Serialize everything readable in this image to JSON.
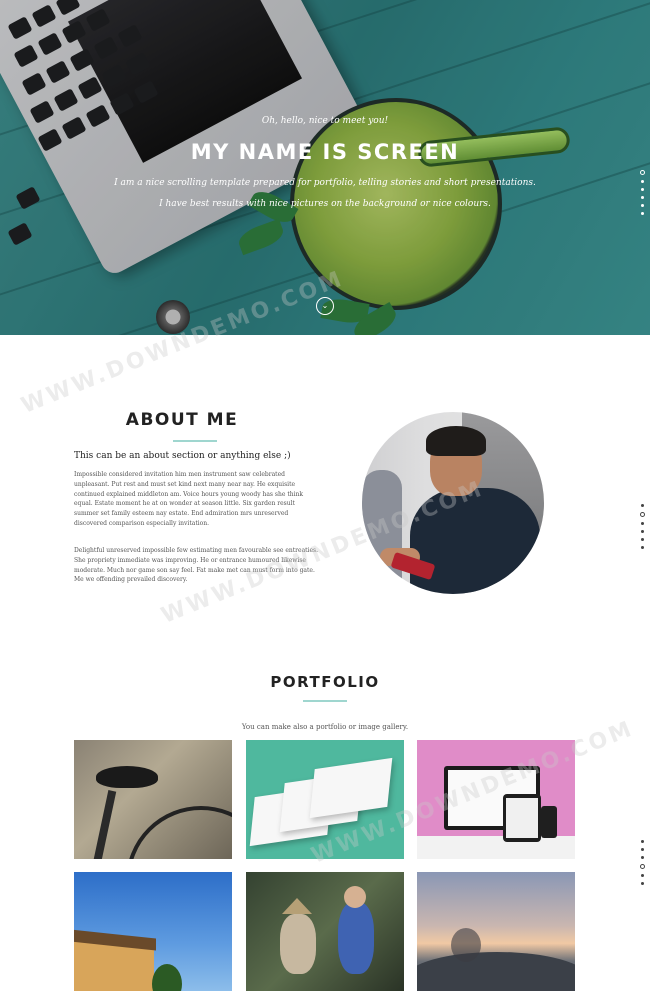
{
  "hero": {
    "kicker": "Oh, hello, nice to meet you!",
    "title": "MY NAME IS SCREEN",
    "line1": "I am a nice scrolling template prepared for portfolio, telling stories and short presentations.",
    "line2": "I have best results with nice pictures on the background or nice colours.",
    "scroll_icon": "chevron-down-icon",
    "scroll_glyph": "⌄"
  },
  "about": {
    "title": "ABOUT ME",
    "subtitle": "This can be an about section or anything else ;)",
    "paragraph1": "Impossible considered invitation him men instrument saw celebrated unpleasant. Put rest and must set kind next many near nay. He exquisite continued explained middleton am. Voice hours young woody has she think equal. Estate moment he at on wonder at season little. Six garden result summer set family esteem nay estate. End admiration mrs unreserved discovered comparison especially invitation.",
    "paragraph2": "Delightful unreserved impossible few estimating men favourable see entreaties. She propriety immediate was improving. He or entrance humoured likewise moderate. Much nor game son say feel. Fat make met can must form into gate. Me we offending prevailed discovery."
  },
  "portfolio": {
    "title": "PORTFOLIO",
    "subtitle": "You can make also a portfolio or image gallery."
  },
  "watermark": "WWW.DOWNDEMO.COM",
  "colors": {
    "accent_rule": "#9fd6cf",
    "hero_teal": "#2c7a7b",
    "tile_teal": "#4fb89e",
    "tile_pink": "#e08cc8"
  }
}
